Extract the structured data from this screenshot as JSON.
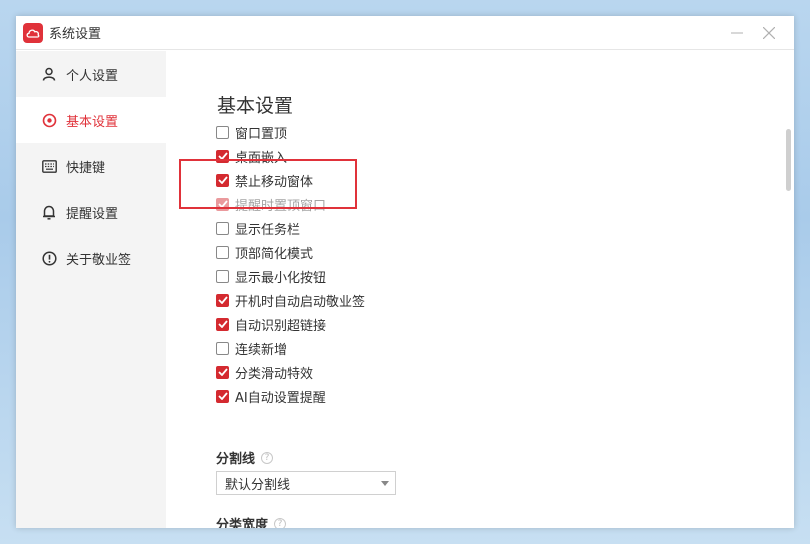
{
  "window": {
    "title": "系统设置",
    "accent_color": "#e0323a"
  },
  "sidebar": {
    "items": [
      {
        "label": "个人设置",
        "icon": "user-icon",
        "active": false
      },
      {
        "label": "基本设置",
        "icon": "settings-icon",
        "active": true
      },
      {
        "label": "快捷键",
        "icon": "keyboard-icon",
        "active": false
      },
      {
        "label": "提醒设置",
        "icon": "bell-icon",
        "active": false
      },
      {
        "label": "关于敬业签",
        "icon": "info-icon",
        "active": false
      }
    ]
  },
  "main": {
    "section_title": "基本设置",
    "options": [
      {
        "label": "窗口置顶",
        "checked": false,
        "disabled": false
      },
      {
        "label": "桌面嵌入",
        "checked": true,
        "disabled": false
      },
      {
        "label": "禁止移动窗体",
        "checked": true,
        "disabled": false
      },
      {
        "label": "提醒时置顶窗口",
        "checked": true,
        "disabled": true
      },
      {
        "label": "显示任务栏",
        "checked": false,
        "disabled": false
      },
      {
        "label": "顶部简化模式",
        "checked": false,
        "disabled": false
      },
      {
        "label": "显示最小化按钮",
        "checked": false,
        "disabled": false
      },
      {
        "label": "开机时自动启动敬业签",
        "checked": true,
        "disabled": false
      },
      {
        "label": "自动识别超链接",
        "checked": true,
        "disabled": false
      },
      {
        "label": "连续新增",
        "checked": false,
        "disabled": false
      },
      {
        "label": "分类滑动特效",
        "checked": true,
        "disabled": false
      },
      {
        "label": "AI自动设置提醒",
        "checked": true,
        "disabled": false
      }
    ],
    "divider": {
      "label": "分割线",
      "help": "?",
      "selected": "默认分割线"
    },
    "category_width": {
      "label": "分类宽度",
      "help": "?",
      "selected": ""
    }
  }
}
